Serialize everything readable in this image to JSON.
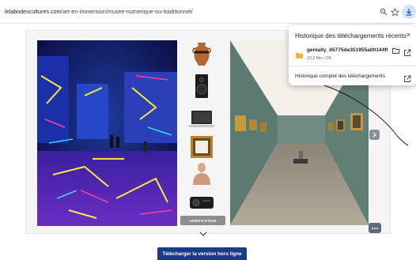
{
  "browser": {
    "url_host": "lelabodescultures.com",
    "url_path": "/art-en-immersion/musee-numerique-ou-traditionnel/",
    "icons": [
      "zoom-icon",
      "star-icon",
      "download-icon"
    ]
  },
  "content": {
    "left_image": "immersive neon gallery room",
    "right_image": "traditional museum gallery hall",
    "objects": [
      "amphora",
      "speaker",
      "laptop",
      "picture-frame",
      "bust",
      "projector"
    ],
    "verification_label": "VERIFICATION",
    "offline_button_label": "Télécharger la version hors ligne"
  },
  "downloads_popup": {
    "title": "Historique des téléchargements récents",
    "file_name": "genially_65775de351955a00144ff",
    "file_meta": "23,2 Mo • OK",
    "history_link": "Historique complet des téléchargements"
  },
  "colors": {
    "accent_button": "#1a3a8a",
    "download_bubble": "#d3e3fd",
    "gallery_wall": "#5c7a72"
  }
}
